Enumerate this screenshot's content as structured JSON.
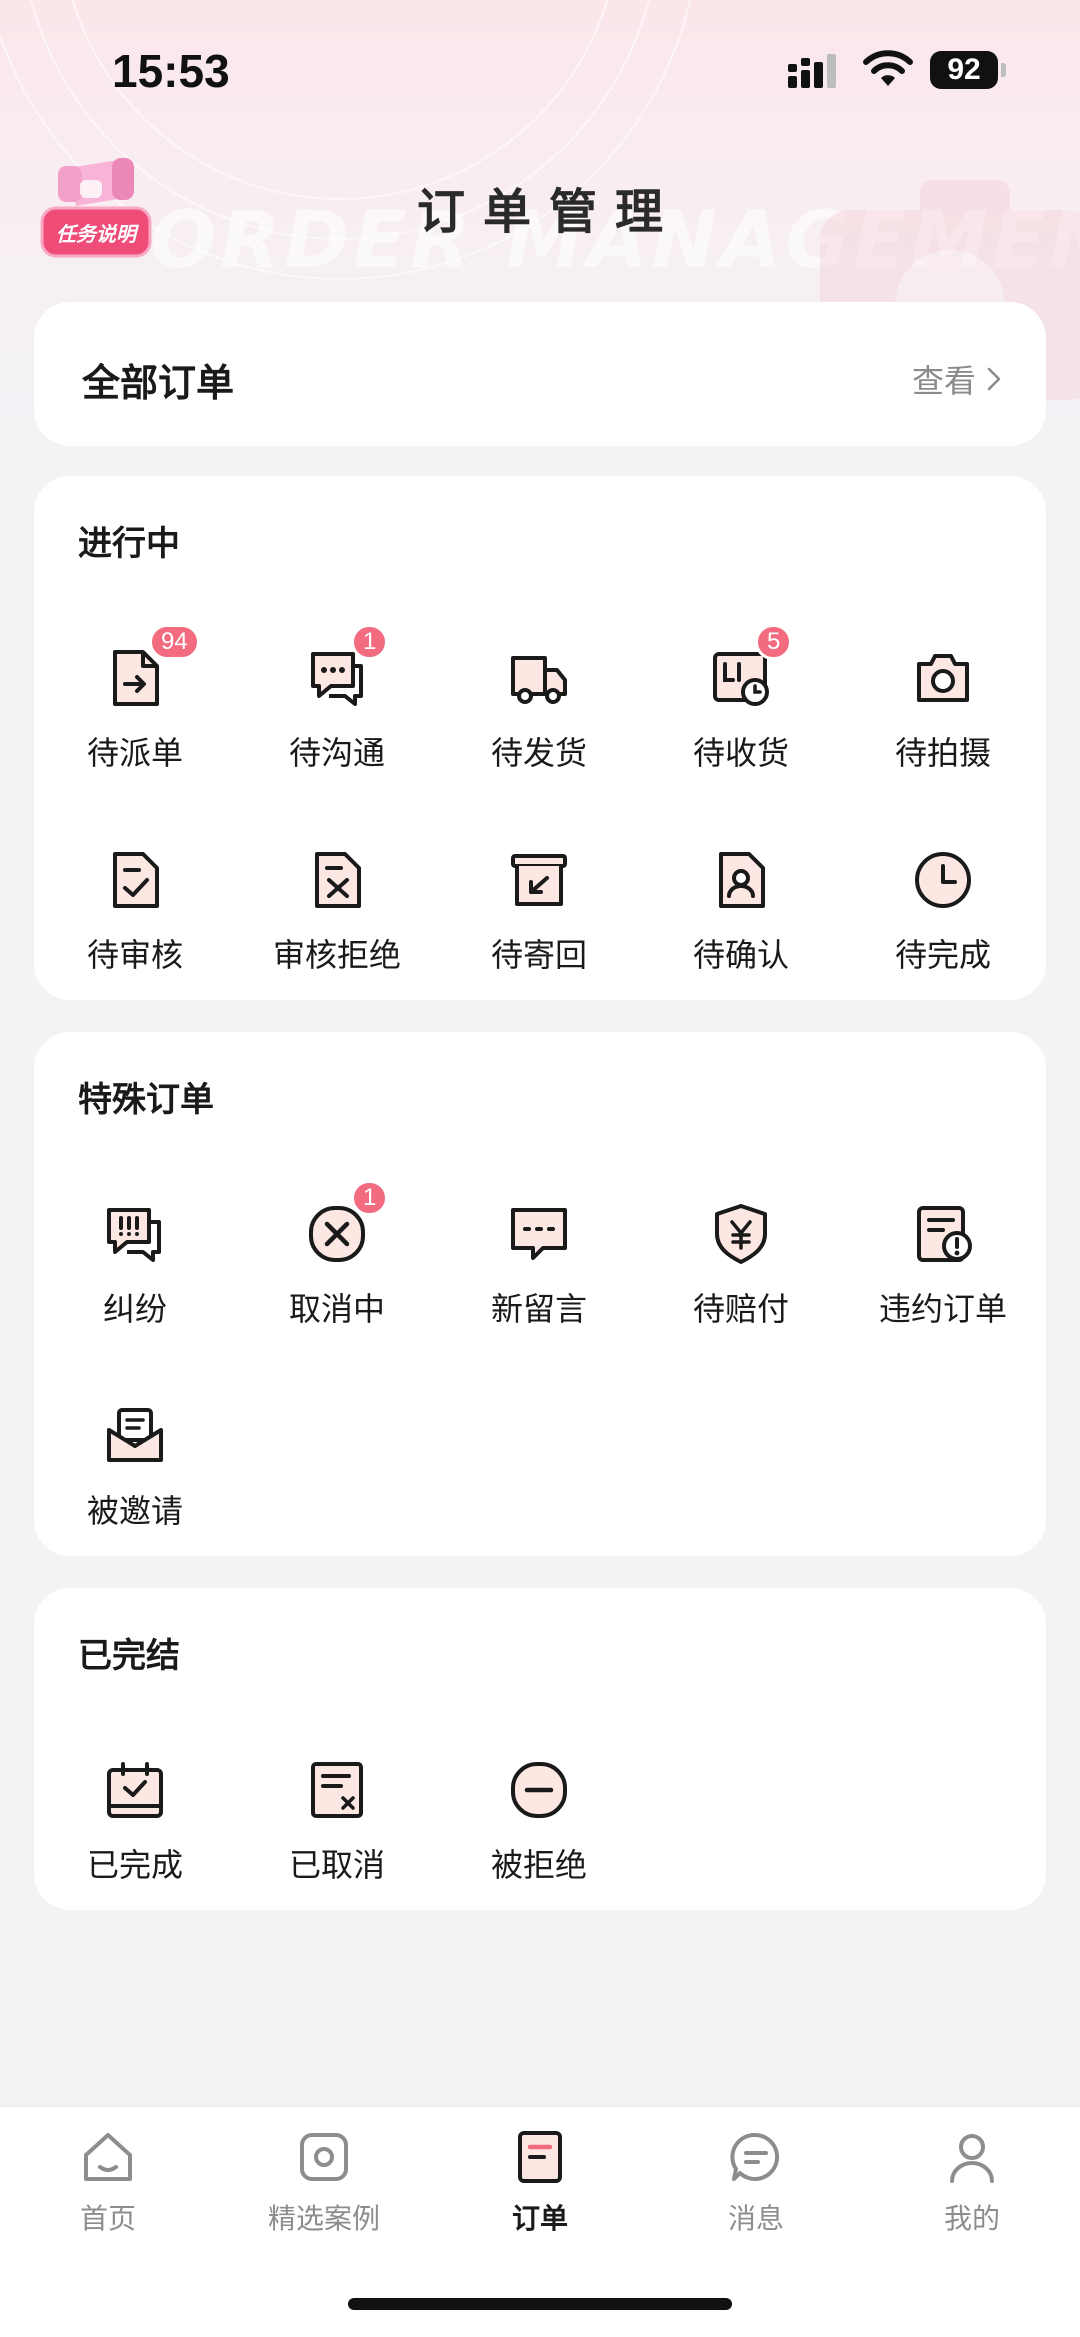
{
  "status_bar": {
    "time": "15:53",
    "battery": "92"
  },
  "header": {
    "title": "订单管理",
    "watermark": "ORDER MANAGEMENT",
    "task_badge_label": "任务说明"
  },
  "all_orders": {
    "label": "全部订单",
    "view_label": "查看"
  },
  "sections": [
    {
      "title": "进行中",
      "items": [
        {
          "label": "待派单",
          "icon": "dispatch-icon",
          "badge": "94"
        },
        {
          "label": "待沟通",
          "icon": "chat-icon",
          "badge": "1"
        },
        {
          "label": "待发货",
          "icon": "truck-icon",
          "badge": ""
        },
        {
          "label": "待收货",
          "icon": "receive-icon",
          "badge": "5"
        },
        {
          "label": "待拍摄",
          "icon": "camera-icon",
          "badge": ""
        },
        {
          "label": "待审核",
          "icon": "review-icon",
          "badge": ""
        },
        {
          "label": "审核拒绝",
          "icon": "review-reject-icon",
          "badge": ""
        },
        {
          "label": "待寄回",
          "icon": "send-back-icon",
          "badge": ""
        },
        {
          "label": "待确认",
          "icon": "confirm-icon",
          "badge": ""
        },
        {
          "label": "待完成",
          "icon": "clock-icon",
          "badge": ""
        }
      ]
    },
    {
      "title": "特殊订单",
      "items": [
        {
          "label": "纠纷",
          "icon": "dispute-icon",
          "badge": ""
        },
        {
          "label": "取消中",
          "icon": "cancel-circle-icon",
          "badge": "1"
        },
        {
          "label": "新留言",
          "icon": "message-icon",
          "badge": ""
        },
        {
          "label": "待赔付",
          "icon": "shield-yen-icon",
          "badge": ""
        },
        {
          "label": "违约订单",
          "icon": "breach-icon",
          "badge": ""
        },
        {
          "label": "被邀请",
          "icon": "invite-icon",
          "badge": ""
        }
      ]
    },
    {
      "title": "已完结",
      "items": [
        {
          "label": "已完成",
          "icon": "calendar-check-icon",
          "badge": ""
        },
        {
          "label": "已取消",
          "icon": "doc-cancel-icon",
          "badge": ""
        },
        {
          "label": "被拒绝",
          "icon": "minus-circle-icon",
          "badge": ""
        }
      ]
    }
  ],
  "tabbar": {
    "items": [
      {
        "label": "首页",
        "icon": "home-icon"
      },
      {
        "label": "精选案例",
        "icon": "camera-square-icon"
      },
      {
        "label": "订单",
        "icon": "order-icon",
        "active": true
      },
      {
        "label": "消息",
        "icon": "message-bubble-icon"
      },
      {
        "label": "我的",
        "icon": "profile-icon"
      }
    ]
  },
  "colors": {
    "accent": "#f36b7f",
    "background": "#f3f3f6",
    "icon_fill": "#fde7e3"
  }
}
